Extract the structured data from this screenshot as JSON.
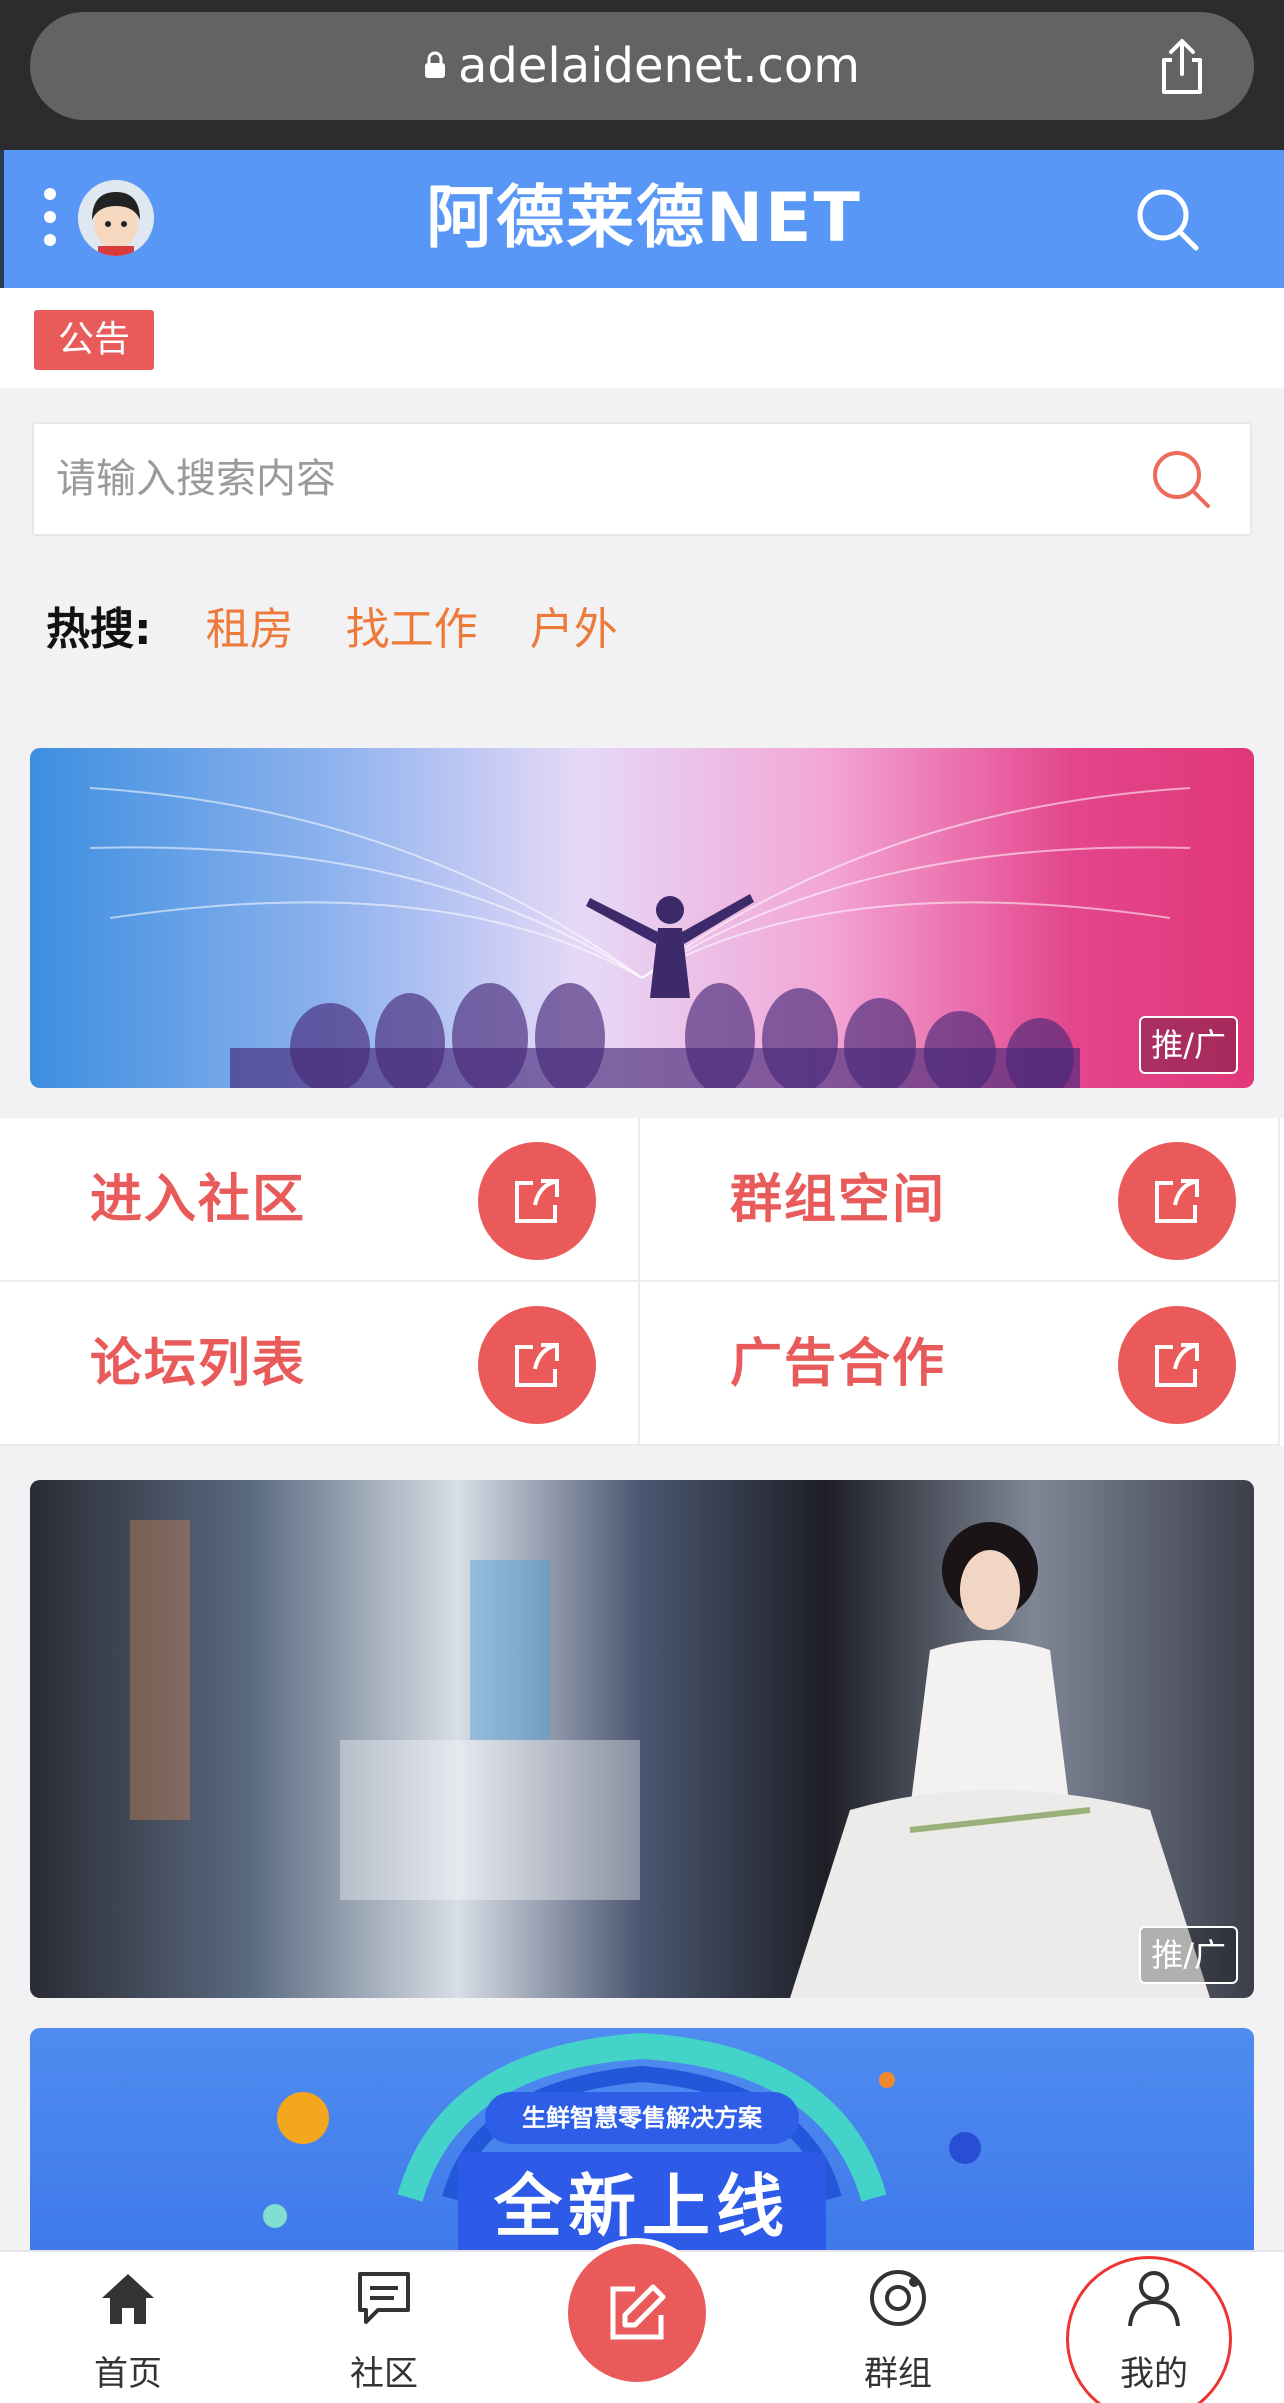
{
  "browser": {
    "url": "adelaidenet.com"
  },
  "header": {
    "title": "阿德莱德NET"
  },
  "notice": {
    "badge": "公告"
  },
  "search": {
    "placeholder": "请输入搜索内容"
  },
  "hot": {
    "label": "热搜:",
    "items": [
      "租房",
      "找工作",
      "户外"
    ]
  },
  "banners": {
    "ad_tag": "推/广"
  },
  "entries": [
    {
      "label": "进入社区"
    },
    {
      "label": "群组空间"
    },
    {
      "label": "论坛列表"
    },
    {
      "label": "广告合作"
    }
  ],
  "banner3": {
    "subtitle": "生鲜智慧零售解决方案",
    "headline": "全新上线"
  },
  "tabbar": {
    "home": "首页",
    "community": "社区",
    "groups": "群组",
    "mine": "我的"
  },
  "colors": {
    "brand_blue": "#5897f5",
    "accent_red": "#e95a5a",
    "hot_orange": "#ee7a3a"
  }
}
